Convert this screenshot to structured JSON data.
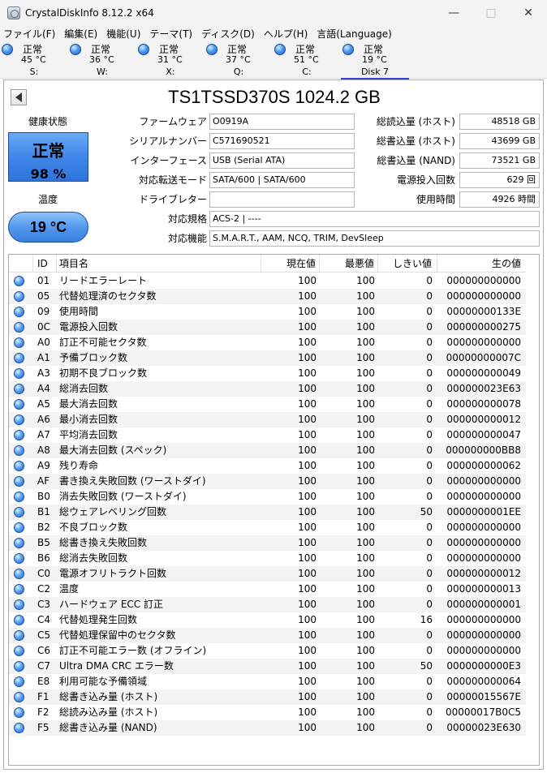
{
  "window": {
    "title": "CrystalDiskInfo 8.12.2 x64"
  },
  "menu": [
    "ファイル(F)",
    "編集(E)",
    "機能(U)",
    "テーマ(T)",
    "ディスク(D)",
    "ヘルプ(H)",
    "言語(Language)"
  ],
  "disks": [
    {
      "status": "正常",
      "temp": "45 °C",
      "label": "S:"
    },
    {
      "status": "正常",
      "temp": "36 °C",
      "label": "W:"
    },
    {
      "status": "正常",
      "temp": "31 °C",
      "label": "X:"
    },
    {
      "status": "正常",
      "temp": "37 °C",
      "label": "Q:"
    },
    {
      "status": "正常",
      "temp": "51 °C",
      "label": "C:"
    },
    {
      "status": "正常",
      "temp": "19 °C",
      "label": "Disk 7"
    }
  ],
  "drive": {
    "title": "TS1TSSD370S 1024.2 GB"
  },
  "health": {
    "label": "健康状態",
    "status": "正常",
    "percent": "98 %"
  },
  "temperature": {
    "label": "温度",
    "value": "19 °C"
  },
  "info": {
    "firmware": {
      "label": "ファームウェア",
      "value": "O0919A"
    },
    "serial": {
      "label": "シリアルナンバー",
      "value": "C571690521"
    },
    "interface": {
      "label": "インターフェース",
      "value": "USB (Serial ATA)"
    },
    "transfer": {
      "label": "対応転送モード",
      "value": "SATA/600 | SATA/600"
    },
    "drive_letter": {
      "label": "ドライブレター",
      "value": ""
    },
    "standard": {
      "label": "対応規格",
      "value": "ACS-2 | ----"
    },
    "features": {
      "label": "対応機能",
      "value": "S.M.A.R.T., AAM, NCQ, TRIM, DevSleep"
    },
    "host_reads": {
      "label": "総読込量 (ホスト)",
      "value": "48518 GB"
    },
    "host_writes": {
      "label": "総書込量 (ホスト)",
      "value": "43699 GB"
    },
    "nand_writes": {
      "label": "総書込量 (NAND)",
      "value": "73521 GB"
    },
    "power_count": {
      "label": "電源投入回数",
      "value": "629 回"
    },
    "power_hours": {
      "label": "使用時間",
      "value": "4926 時間"
    }
  },
  "smart_headers": {
    "id": "ID",
    "name": "項目名",
    "current": "現在値",
    "worst": "最悪値",
    "threshold": "しきい値",
    "raw": "生の値"
  },
  "smart_rows": [
    {
      "id": "01",
      "name": "リードエラーレート",
      "current": "100",
      "worst": "100",
      "threshold": "0",
      "raw": "000000000000"
    },
    {
      "id": "05",
      "name": "代替処理済のセクタ数",
      "current": "100",
      "worst": "100",
      "threshold": "0",
      "raw": "000000000000"
    },
    {
      "id": "09",
      "name": "使用時間",
      "current": "100",
      "worst": "100",
      "threshold": "0",
      "raw": "00000000133E"
    },
    {
      "id": "0C",
      "name": "電源投入回数",
      "current": "100",
      "worst": "100",
      "threshold": "0",
      "raw": "000000000275"
    },
    {
      "id": "A0",
      "name": "訂正不可能セクタ数",
      "current": "100",
      "worst": "100",
      "threshold": "0",
      "raw": "000000000000"
    },
    {
      "id": "A1",
      "name": "予備ブロック数",
      "current": "100",
      "worst": "100",
      "threshold": "0",
      "raw": "00000000007C"
    },
    {
      "id": "A3",
      "name": "初期不良ブロック数",
      "current": "100",
      "worst": "100",
      "threshold": "0",
      "raw": "000000000049"
    },
    {
      "id": "A4",
      "name": "総消去回数",
      "current": "100",
      "worst": "100",
      "threshold": "0",
      "raw": "000000023E63"
    },
    {
      "id": "A5",
      "name": "最大消去回数",
      "current": "100",
      "worst": "100",
      "threshold": "0",
      "raw": "000000000078"
    },
    {
      "id": "A6",
      "name": "最小消去回数",
      "current": "100",
      "worst": "100",
      "threshold": "0",
      "raw": "000000000012"
    },
    {
      "id": "A7",
      "name": "平均消去回数",
      "current": "100",
      "worst": "100",
      "threshold": "0",
      "raw": "000000000047"
    },
    {
      "id": "A8",
      "name": "最大消去回数 (スペック)",
      "current": "100",
      "worst": "100",
      "threshold": "0",
      "raw": "000000000BB8"
    },
    {
      "id": "A9",
      "name": "残り寿命",
      "current": "100",
      "worst": "100",
      "threshold": "0",
      "raw": "000000000062"
    },
    {
      "id": "AF",
      "name": "書き換え失敗回数 (ワーストダイ)",
      "current": "100",
      "worst": "100",
      "threshold": "0",
      "raw": "000000000000"
    },
    {
      "id": "B0",
      "name": "消去失敗回数 (ワーストダイ)",
      "current": "100",
      "worst": "100",
      "threshold": "0",
      "raw": "000000000000"
    },
    {
      "id": "B1",
      "name": "総ウェアレベリング回数",
      "current": "100",
      "worst": "100",
      "threshold": "50",
      "raw": "0000000001EE"
    },
    {
      "id": "B2",
      "name": "不良ブロック数",
      "current": "100",
      "worst": "100",
      "threshold": "0",
      "raw": "000000000000"
    },
    {
      "id": "B5",
      "name": "総書き換え失敗回数",
      "current": "100",
      "worst": "100",
      "threshold": "0",
      "raw": "000000000000"
    },
    {
      "id": "B6",
      "name": "総消去失敗回数",
      "current": "100",
      "worst": "100",
      "threshold": "0",
      "raw": "000000000000"
    },
    {
      "id": "C0",
      "name": "電源オフリトラクト回数",
      "current": "100",
      "worst": "100",
      "threshold": "0",
      "raw": "000000000012"
    },
    {
      "id": "C2",
      "name": "温度",
      "current": "100",
      "worst": "100",
      "threshold": "0",
      "raw": "000000000013"
    },
    {
      "id": "C3",
      "name": "ハードウェア ECC 訂正",
      "current": "100",
      "worst": "100",
      "threshold": "0",
      "raw": "000000000001"
    },
    {
      "id": "C4",
      "name": "代替処理発生回数",
      "current": "100",
      "worst": "100",
      "threshold": "16",
      "raw": "000000000000"
    },
    {
      "id": "C5",
      "name": "代替処理保留中のセクタ数",
      "current": "100",
      "worst": "100",
      "threshold": "0",
      "raw": "000000000000"
    },
    {
      "id": "C6",
      "name": "訂正不可能エラー数 (オフライン)",
      "current": "100",
      "worst": "100",
      "threshold": "0",
      "raw": "000000000000"
    },
    {
      "id": "C7",
      "name": "Ultra DMA CRC エラー数",
      "current": "100",
      "worst": "100",
      "threshold": "50",
      "raw": "0000000000E3"
    },
    {
      "id": "E8",
      "name": "利用可能な予備領域",
      "current": "100",
      "worst": "100",
      "threshold": "0",
      "raw": "000000000064"
    },
    {
      "id": "F1",
      "name": "総書き込み量 (ホスト)",
      "current": "100",
      "worst": "100",
      "threshold": "0",
      "raw": "00000015567E"
    },
    {
      "id": "F2",
      "name": "総読み込み量 (ホスト)",
      "current": "100",
      "worst": "100",
      "threshold": "0",
      "raw": "00000017B0C5"
    },
    {
      "id": "F5",
      "name": "総書き込み量 (NAND)",
      "current": "100",
      "worst": "100",
      "threshold": "0",
      "raw": "00000023E630"
    }
  ]
}
